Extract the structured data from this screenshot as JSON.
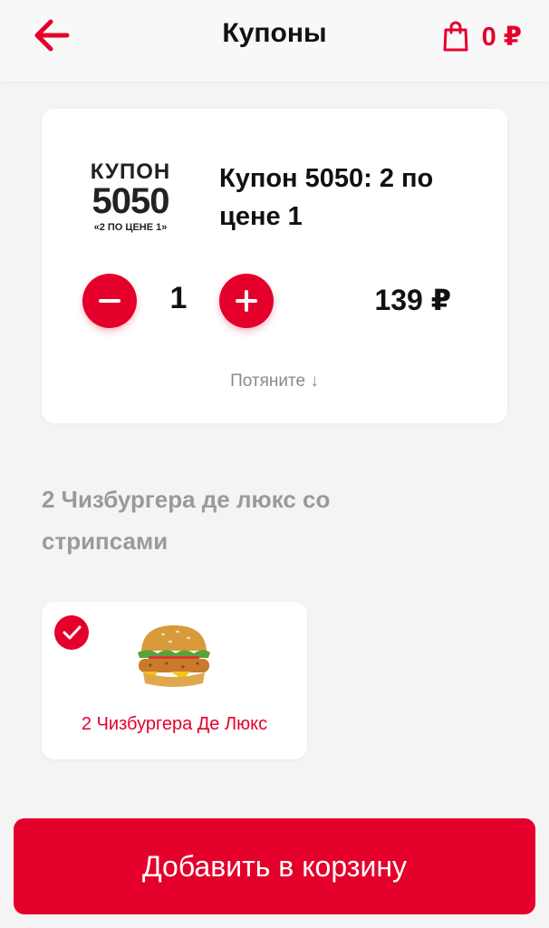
{
  "header": {
    "title": "Купоны",
    "cart_total": "0 ₽"
  },
  "coupon": {
    "logo_line1": "КУПОН",
    "logo_line2": "5050",
    "logo_line3": "«2 ПО ЦЕНЕ 1»",
    "title": "Купон 5050: 2 по цене 1",
    "quantity": "1",
    "price": "139 ₽",
    "pull_hint": "Потяните ↓"
  },
  "section": {
    "title": "2 Чизбургера де люкс со стрипсами"
  },
  "option": {
    "label": "2 Чизбургера Де Люкс",
    "selected": true
  },
  "footer": {
    "add_button": "Добавить в корзину"
  },
  "colors": {
    "accent": "#e4002b",
    "background": "#f4f4f4",
    "muted_text": "#9a9a9a"
  },
  "icons": {
    "back": "arrow-left-icon",
    "cart": "shopping-bag-icon",
    "minus": "minus-icon",
    "plus": "plus-icon",
    "check": "checkmark-icon"
  }
}
